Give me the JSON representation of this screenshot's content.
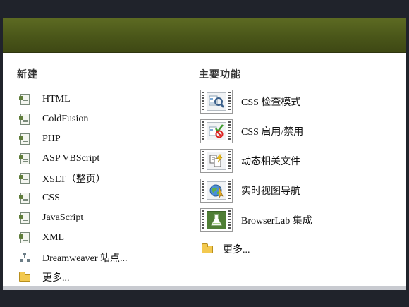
{
  "left": {
    "title": "新建",
    "items": [
      {
        "label": "HTML",
        "icon": "document-icon"
      },
      {
        "label": "ColdFusion",
        "icon": "document-icon"
      },
      {
        "label": "PHP",
        "icon": "document-icon"
      },
      {
        "label": "ASP VBScript",
        "icon": "document-icon"
      },
      {
        "label": "XSLT（整页）",
        "icon": "document-icon"
      },
      {
        "label": "CSS",
        "icon": "document-icon"
      },
      {
        "label": "JavaScript",
        "icon": "document-icon"
      },
      {
        "label": "XML",
        "icon": "document-icon"
      },
      {
        "label": "Dreamweaver 站点...",
        "icon": "site-icon"
      },
      {
        "label": "更多...",
        "icon": "folder-icon"
      }
    ]
  },
  "right": {
    "title": "主要功能",
    "items": [
      {
        "label": "CSS 检查模式",
        "icon": "css-inspect-icon"
      },
      {
        "label": "CSS 启用/禁用",
        "icon": "css-enable-disable-icon"
      },
      {
        "label": "动态相关文件",
        "icon": "related-files-icon"
      },
      {
        "label": "实时视图导航",
        "icon": "live-view-navigation-icon"
      },
      {
        "label": "BrowserLab 集成",
        "icon": "browserlab-icon"
      }
    ],
    "more": "更多..."
  }
}
